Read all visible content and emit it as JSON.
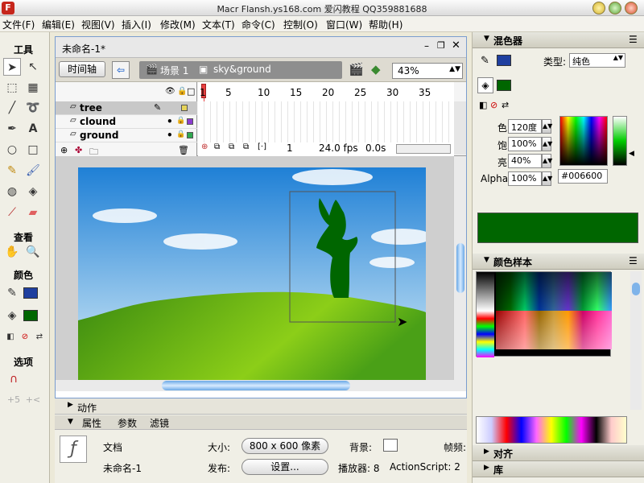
{
  "window": {
    "title": "Macr Flansh.ys168.com 爱闪教程 QQ359881688",
    "app_icon_letter": "F"
  },
  "menu": [
    "文件(F)",
    "编辑(E)",
    "视图(V)",
    "插入(I)",
    "修改(M)",
    "文本(T)",
    "命令(C)",
    "控制(O)",
    "窗口(W)",
    "帮助(H)"
  ],
  "tools": {
    "header": "工具",
    "view_header": "查看",
    "colors_header": "颜色",
    "options_header": "选项",
    "stroke_color": "#1f3f9f",
    "fill_color": "#006600"
  },
  "document": {
    "tab_title": "未命名-1*",
    "timeline_button": "时间轴",
    "scene": "场景 1",
    "symbol": "sky&ground",
    "zoom": "43%",
    "layers": [
      {
        "name": "tree",
        "color": "#e6d35a"
      },
      {
        "name": "clound",
        "color": "#8b3bd0"
      },
      {
        "name": "ground",
        "color": "#2fa84f"
      }
    ],
    "frame_numbers": [
      "1",
      "5",
      "10",
      "15",
      "20",
      "25",
      "30",
      "35"
    ],
    "current_frame": "1",
    "fps": "24.0 fps",
    "time": "0.0s"
  },
  "properties": {
    "actions_label": "动作",
    "tabs": [
      "属性",
      "参数",
      "滤镜"
    ],
    "doc_label": "文档",
    "doc_name": "未命名-1",
    "size_label": "大小:",
    "size_value": "800 x 600 像素",
    "publish_label": "发布:",
    "settings_label": "设置...",
    "bg_label": "背景:",
    "fps_label": "帧频:",
    "player_label": "播放器: 8",
    "actionscript_label": "ActionScript: 2"
  },
  "mixer": {
    "title": "混色器",
    "type_label": "类型:",
    "type_value": "纯色",
    "hue_label": "色",
    "hue_value": "120度",
    "sat_label": "饱",
    "sat_value": "100%",
    "bri_label": "亮",
    "bri_value": "40%",
    "alpha_label": "Alpha:",
    "alpha_value": "100%",
    "hex_value": "#006600",
    "color": "#006600"
  },
  "swatches_panel": {
    "title": "颜色样本"
  },
  "align_panel": {
    "title": "对齐"
  },
  "library_panel": {
    "title": "库"
  }
}
